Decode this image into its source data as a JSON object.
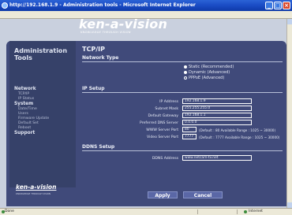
{
  "window": {
    "title": "http://192.168.1.9 - Administration tools - Microsoft Internet Explorer"
  },
  "logo": {
    "word": "ken-a-vision",
    "tagline": "KNOWLEDGE THROUGH VISION"
  },
  "sidebar": {
    "title_line1": "Administration",
    "title_line2": "Tools",
    "sections": [
      {
        "label": "Network",
        "items": [
          "TCP/IP",
          "IP Status"
        ]
      },
      {
        "label": "System",
        "items": [
          "Date/Time",
          "Users",
          "Firmware Update",
          "Default Set",
          "Reboot"
        ]
      },
      {
        "label": "Support",
        "items": []
      }
    ],
    "bottom_logo": "ken-a-vision",
    "bottom_tagline": "KNOWLEDGE THROUGH VISION"
  },
  "main": {
    "title": "TCP/IP",
    "network_type": {
      "heading": "Network Type",
      "options": [
        {
          "label": "Static (Recommended)",
          "selected": false
        },
        {
          "label": "Dynamic (Advanced)",
          "selected": true
        },
        {
          "label": "PPPoE (Advanced)",
          "selected": false
        }
      ]
    },
    "ip_setup": {
      "heading": "IP Setup",
      "ip_address": {
        "label": "IP Address",
        "value": "192.168.1.9"
      },
      "subnet_mask": {
        "label": "Subnet Mask",
        "value": "255.255.255.0"
      },
      "default_gateway": {
        "label": "Default Gateway",
        "value": "192.168.1.1"
      },
      "dns_server": {
        "label": "Preferred DNS Server",
        "value": "0.0.0.0"
      },
      "www_port": {
        "label": "WWW Server Port",
        "value": "80",
        "note": "(Default : 80  Available Range : 1025 ~ 30000)"
      },
      "video_port": {
        "label": "Video Server Port",
        "value": "7777",
        "note": "(Default : 7777  Available Range : 1025 ~ 30000)"
      }
    },
    "ddns_setup": {
      "heading": "DDNS Setup",
      "ddns_address": {
        "label": "DDNS Address",
        "value": "www.netcam-tv.net"
      }
    },
    "apply_label": "Apply",
    "cancel_label": "Cancel"
  },
  "statusbar": {
    "left": "Done",
    "right": "Internet"
  }
}
